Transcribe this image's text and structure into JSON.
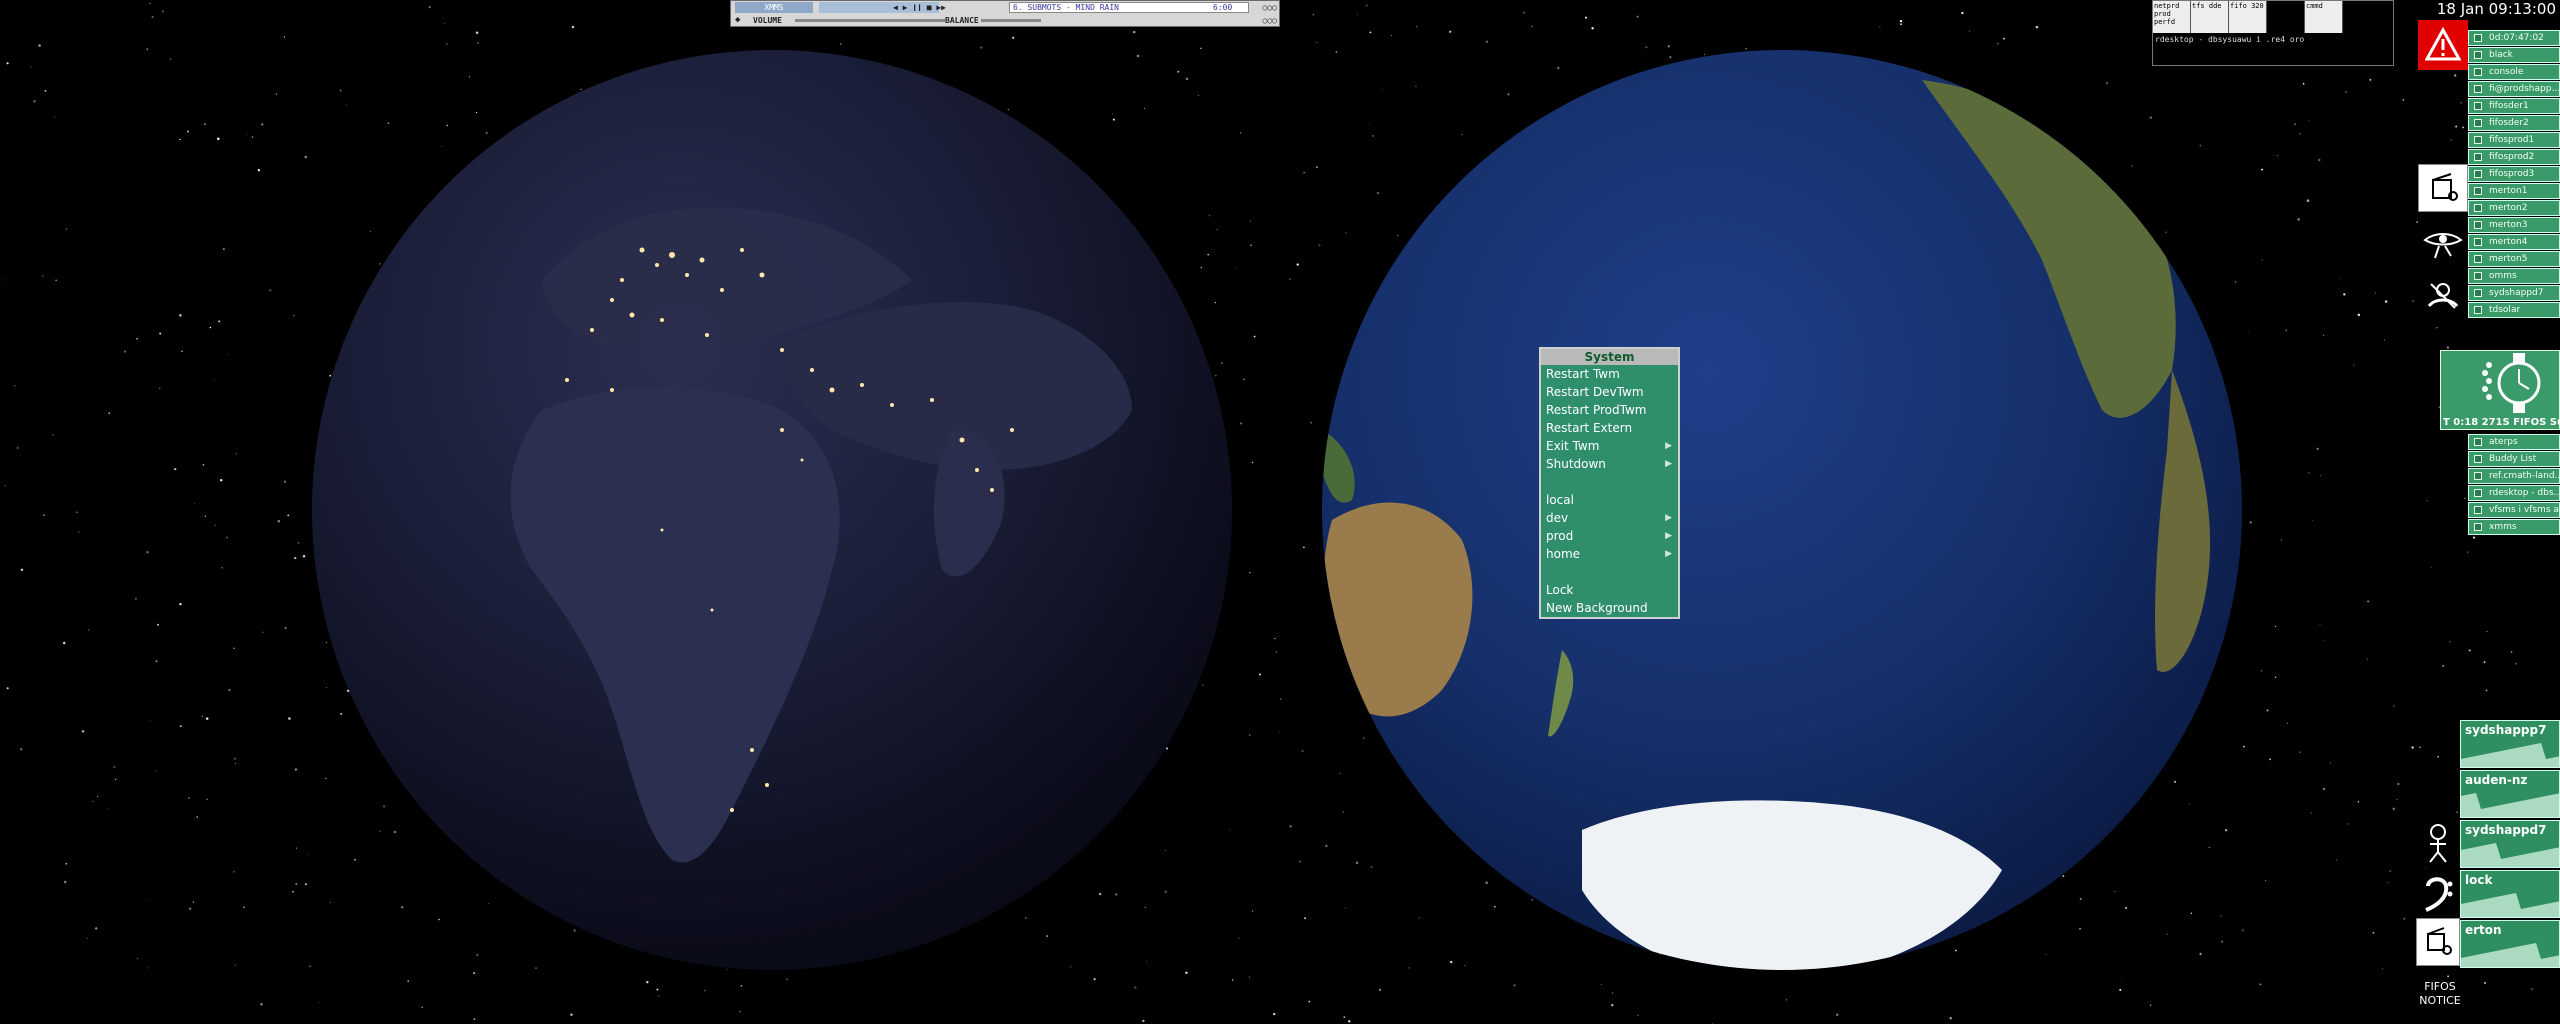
{
  "clock": {
    "text": "18 Jan 09:13:00"
  },
  "xmms": {
    "logo": "XMMS",
    "controls": "◀ ▶ ❙❙ ■ ▶▶",
    "track": "6. SUBMOTS - MIND RAIN",
    "time": "6:00",
    "volume_label": "VOLUME",
    "balance_label": "BALANCE"
  },
  "terminal": {
    "cells": [
      "netprd prod perfd",
      "tfs dde",
      "fifo 320",
      "",
      "cmmd"
    ],
    "command": "rdesktop - dbsysuawu i .re4 oro"
  },
  "window_list": [
    {
      "label": "0d:07:47:02"
    },
    {
      "label": "black"
    },
    {
      "label": "console"
    },
    {
      "label": "fi@prodshapp..."
    },
    {
      "label": "fifosder1"
    },
    {
      "label": "fifosder2"
    },
    {
      "label": "fifosprod1"
    },
    {
      "label": "fifosprod2"
    },
    {
      "label": "fifosprod3"
    },
    {
      "label": "merton1"
    },
    {
      "label": "merton2"
    },
    {
      "label": "merton3"
    },
    {
      "label": "merton4"
    },
    {
      "label": "merton5"
    },
    {
      "label": "omms"
    },
    {
      "label": "sydshappd7"
    },
    {
      "label": "tdsolar"
    }
  ],
  "watch": {
    "caption": "T  0:18 271S FIFOS Sup"
  },
  "window_list_2": [
    {
      "label": "aterps"
    },
    {
      "label": "Buddy List"
    },
    {
      "label": "ref.cmath-land..."
    },
    {
      "label": "rdesktop - dbs..."
    },
    {
      "label": "vfsms i vfsms a..."
    },
    {
      "label": "xmms"
    }
  ],
  "monitors": [
    {
      "label": "sydshappp7"
    },
    {
      "label": "auden-nz"
    },
    {
      "label": "sydshappd7"
    },
    {
      "label": "lock"
    },
    {
      "label": "erton"
    }
  ],
  "notice": {
    "line1": "FIFOS",
    "line2": "NOTICE"
  },
  "menu": {
    "title": "System",
    "items": [
      {
        "label": "Restart Twm",
        "submenu": false
      },
      {
        "label": "Restart DevTwm",
        "submenu": false
      },
      {
        "label": "Restart ProdTwm",
        "submenu": false
      },
      {
        "label": "Restart Extern",
        "submenu": false
      },
      {
        "label": "Exit Twm",
        "submenu": true
      },
      {
        "label": "Shutdown",
        "submenu": true
      },
      {
        "label": "",
        "gap": true
      },
      {
        "label": "local",
        "submenu": false
      },
      {
        "label": "dev",
        "submenu": true
      },
      {
        "label": "prod",
        "submenu": true
      },
      {
        "label": "home",
        "submenu": true
      },
      {
        "label": "",
        "gap": true
      },
      {
        "label": "Lock",
        "submenu": false
      },
      {
        "label": "New Background",
        "submenu": false
      }
    ]
  },
  "colors": {
    "menu_bg": "#2f8f6a",
    "panel_green": "#3a9a6a",
    "alert_red": "#e00000"
  }
}
